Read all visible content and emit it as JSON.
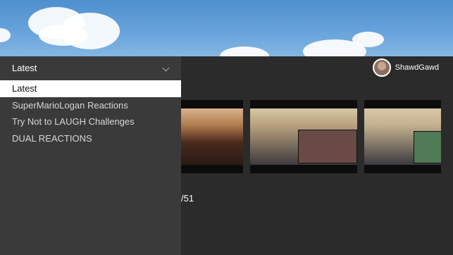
{
  "dropdown": {
    "selected_label": "Latest",
    "chevron_icon": "chevron-down-icon",
    "options": [
      "Latest",
      "SuperMarioLogan Reactions",
      "Try Not to LAUGH Challenges",
      "DUAL REACTIONS"
    ]
  },
  "channel": {
    "name": "ShawdGawd"
  },
  "counter_text": "/51",
  "colors": {
    "panel": "#3a3a3a",
    "background": "#2b2b2b",
    "selected_bg": "#ffffff"
  }
}
